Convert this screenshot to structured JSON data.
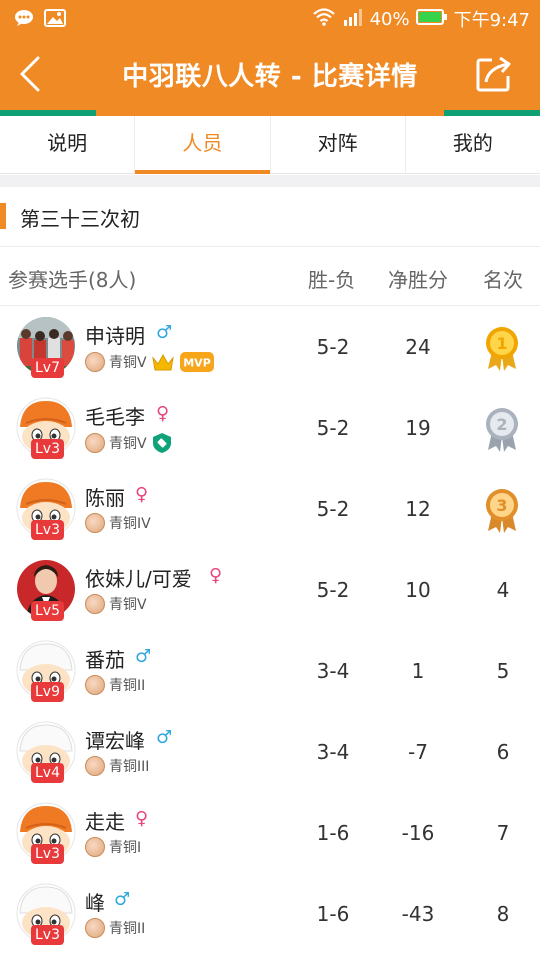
{
  "status_bar": {
    "battery_percent": "40%",
    "time": "下午9:47"
  },
  "header": {
    "title": "中羽联八人转 - 比赛详情",
    "back_icon": "chevron-left-icon",
    "share_icon": "share-icon"
  },
  "tabs": [
    {
      "label": "说明",
      "active": false
    },
    {
      "label": "人员",
      "active": true
    },
    {
      "label": "对阵",
      "active": false
    },
    {
      "label": "我的",
      "active": false
    }
  ],
  "section": {
    "title": "第三十三次初"
  },
  "table": {
    "headers": {
      "player": "参赛选手(8人)",
      "win_loss": "胜-负",
      "net_points": "净胜分",
      "rank": "名次"
    },
    "rows": [
      {
        "name": "申诗明",
        "gender": "♂",
        "gender_type": "male",
        "level": "Lv7",
        "tier": "青铜V",
        "extras": [
          "crown-icon",
          "mvp-badge"
        ],
        "mvp_label": "MVP",
        "win_loss": "5-2",
        "net": "24",
        "rank": "1",
        "medal": "gold",
        "avatar": "photo-group"
      },
      {
        "name": "毛毛李",
        "gender": "♀",
        "gender_type": "female",
        "level": "Lv3",
        "tier": "青铜V",
        "extras": [
          "shield-icon"
        ],
        "win_loss": "5-2",
        "net": "19",
        "rank": "2",
        "medal": "silver",
        "avatar": "cartoon-orange"
      },
      {
        "name": "陈丽",
        "gender": "♀",
        "gender_type": "female",
        "level": "Lv3",
        "tier": "青铜IV",
        "extras": [],
        "win_loss": "5-2",
        "net": "12",
        "rank": "3",
        "medal": "bronze",
        "avatar": "cartoon-orange"
      },
      {
        "name": "依妹儿/可爱",
        "gender": "♀",
        "gender_type": "female",
        "level": "Lv5",
        "tier": "青铜V",
        "extras": [],
        "win_loss": "5-2",
        "net": "10",
        "rank": "4",
        "medal": "",
        "avatar": "photo-woman"
      },
      {
        "name": "番茄",
        "gender": "♂",
        "gender_type": "male",
        "level": "Lv9",
        "tier": "青铜II",
        "extras": [],
        "win_loss": "3-4",
        "net": "1",
        "rank": "5",
        "medal": "",
        "avatar": "cartoon-white"
      },
      {
        "name": "谭宏峰",
        "gender": "♂",
        "gender_type": "male",
        "level": "Lv4",
        "tier": "青铜III",
        "extras": [],
        "win_loss": "3-4",
        "net": "-7",
        "rank": "6",
        "medal": "",
        "avatar": "cartoon-white"
      },
      {
        "name": "走走",
        "gender": "♀",
        "gender_type": "female",
        "level": "Lv3",
        "tier": "青铜I",
        "extras": [],
        "win_loss": "1-6",
        "net": "-16",
        "rank": "7",
        "medal": "",
        "avatar": "cartoon-orange"
      },
      {
        "name": "峰",
        "gender": "♂",
        "gender_type": "male",
        "level": "Lv3",
        "tier": "青铜II",
        "extras": [],
        "win_loss": "1-6",
        "net": "-43",
        "rank": "8",
        "medal": "",
        "avatar": "cartoon-white"
      }
    ]
  },
  "colors": {
    "brand_orange": "#f08a24",
    "accent_green": "#0f9f74",
    "level_red": "#e8393b",
    "male_blue": "#2ea7e0",
    "female_pink": "#e8467a"
  }
}
